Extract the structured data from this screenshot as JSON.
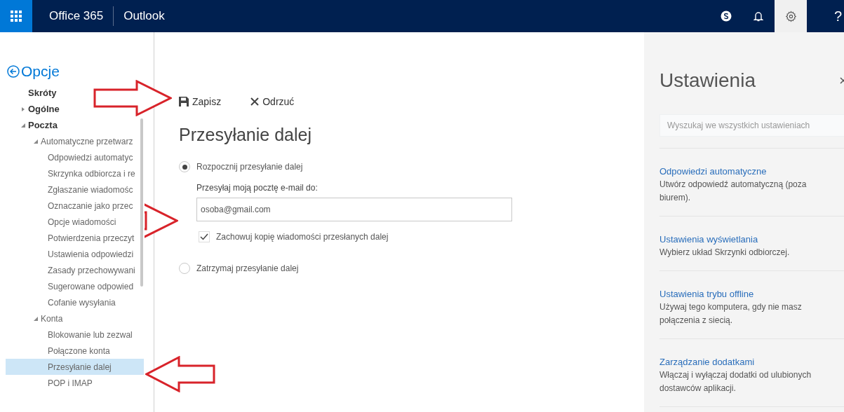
{
  "header": {
    "app_launcher": true,
    "suite_title": "Office 365",
    "app_title": "Outlook",
    "buttons": [
      {
        "kind": "skype",
        "selected": false
      },
      {
        "kind": "bell",
        "selected": false
      },
      {
        "kind": "gear",
        "selected": true
      },
      {
        "kind": "help",
        "label": "?",
        "selected": false
      }
    ]
  },
  "sidebar": {
    "back_label": "Opcje",
    "items": [
      {
        "label": "Skróty",
        "selected": false
      },
      {
        "label": "Ogólne",
        "selected": false,
        "expanded": false
      },
      {
        "label": "Poczta",
        "selected": false,
        "expanded": true,
        "children": [
          {
            "label": "Automatyczne przetwarz",
            "selected": false,
            "expanded": true,
            "children": [
              {
                "label": "Odpowiedzi automatyc",
                "selected": false
              },
              {
                "label": "Skrzynka odbiorcza i re",
                "selected": false
              },
              {
                "label": "Zgłaszanie wiadomośc",
                "selected": false
              },
              {
                "label": "Oznaczanie jako przec",
                "selected": false
              },
              {
                "label": "Opcje wiadomości",
                "selected": false
              },
              {
                "label": "Potwierdzenia przeczyt",
                "selected": false
              },
              {
                "label": "Ustawienia odpowiedzi",
                "selected": false
              },
              {
                "label": "Zasady przechowywani",
                "selected": false
              },
              {
                "label": "Sugerowane odpowied",
                "selected": false
              },
              {
                "label": "Cofanie wysyłania",
                "selected": false
              }
            ]
          },
          {
            "label": "Konta",
            "selected": false,
            "expanded": true,
            "children": [
              {
                "label": "Blokowanie lub zezwal",
                "selected": false
              },
              {
                "label": "Połączone konta",
                "selected": false
              },
              {
                "label": "Przesyłanie dalej",
                "selected": true
              },
              {
                "label": "POP i IMAP",
                "selected": false
              }
            ]
          }
        ]
      }
    ]
  },
  "toolbar": [
    {
      "kind": "save",
      "label": "Zapisz"
    },
    {
      "kind": "discard",
      "label": "Odrzuć"
    }
  ],
  "main": {
    "title": "Przesyłanie dalej",
    "start_option": {
      "label": "Rozpocznij przesyłanie dalej",
      "selected": true
    },
    "forward_label": "Przesyłaj moją pocztę e-mail do:",
    "forward_value": "osoba@gmail.com",
    "keep_copy": {
      "label": "Zachowuj kopię wiadomości przesłanych dalej",
      "checked": true
    },
    "stop_option": {
      "label": "Zatrzymaj przesyłanie dalej",
      "selected": false
    }
  },
  "settings_panel": {
    "title": "Ustawienia",
    "search_placeholder": "Wyszukaj we wszystkich ustawieniach",
    "items": [
      {
        "title": "Odpowiedzi automatyczne",
        "description": "Utwórz odpowiedź automatyczną (poza biurem)."
      },
      {
        "title": "Ustawienia wyświetlania",
        "description": "Wybierz układ Skrzynki odbiorczej."
      },
      {
        "title": "Ustawienia trybu offline",
        "description": "Używaj tego komputera, gdy nie masz połączenia z siecią."
      },
      {
        "title": "Zarządzanie dodatkami",
        "description": "Włączaj i wyłączaj dodatki od ulubionych dostawców aplikacji."
      }
    ]
  },
  "annotations": [
    {
      "kind": "arrow-right"
    },
    {
      "kind": "arrow-right"
    },
    {
      "kind": "arrow-left"
    }
  ]
}
